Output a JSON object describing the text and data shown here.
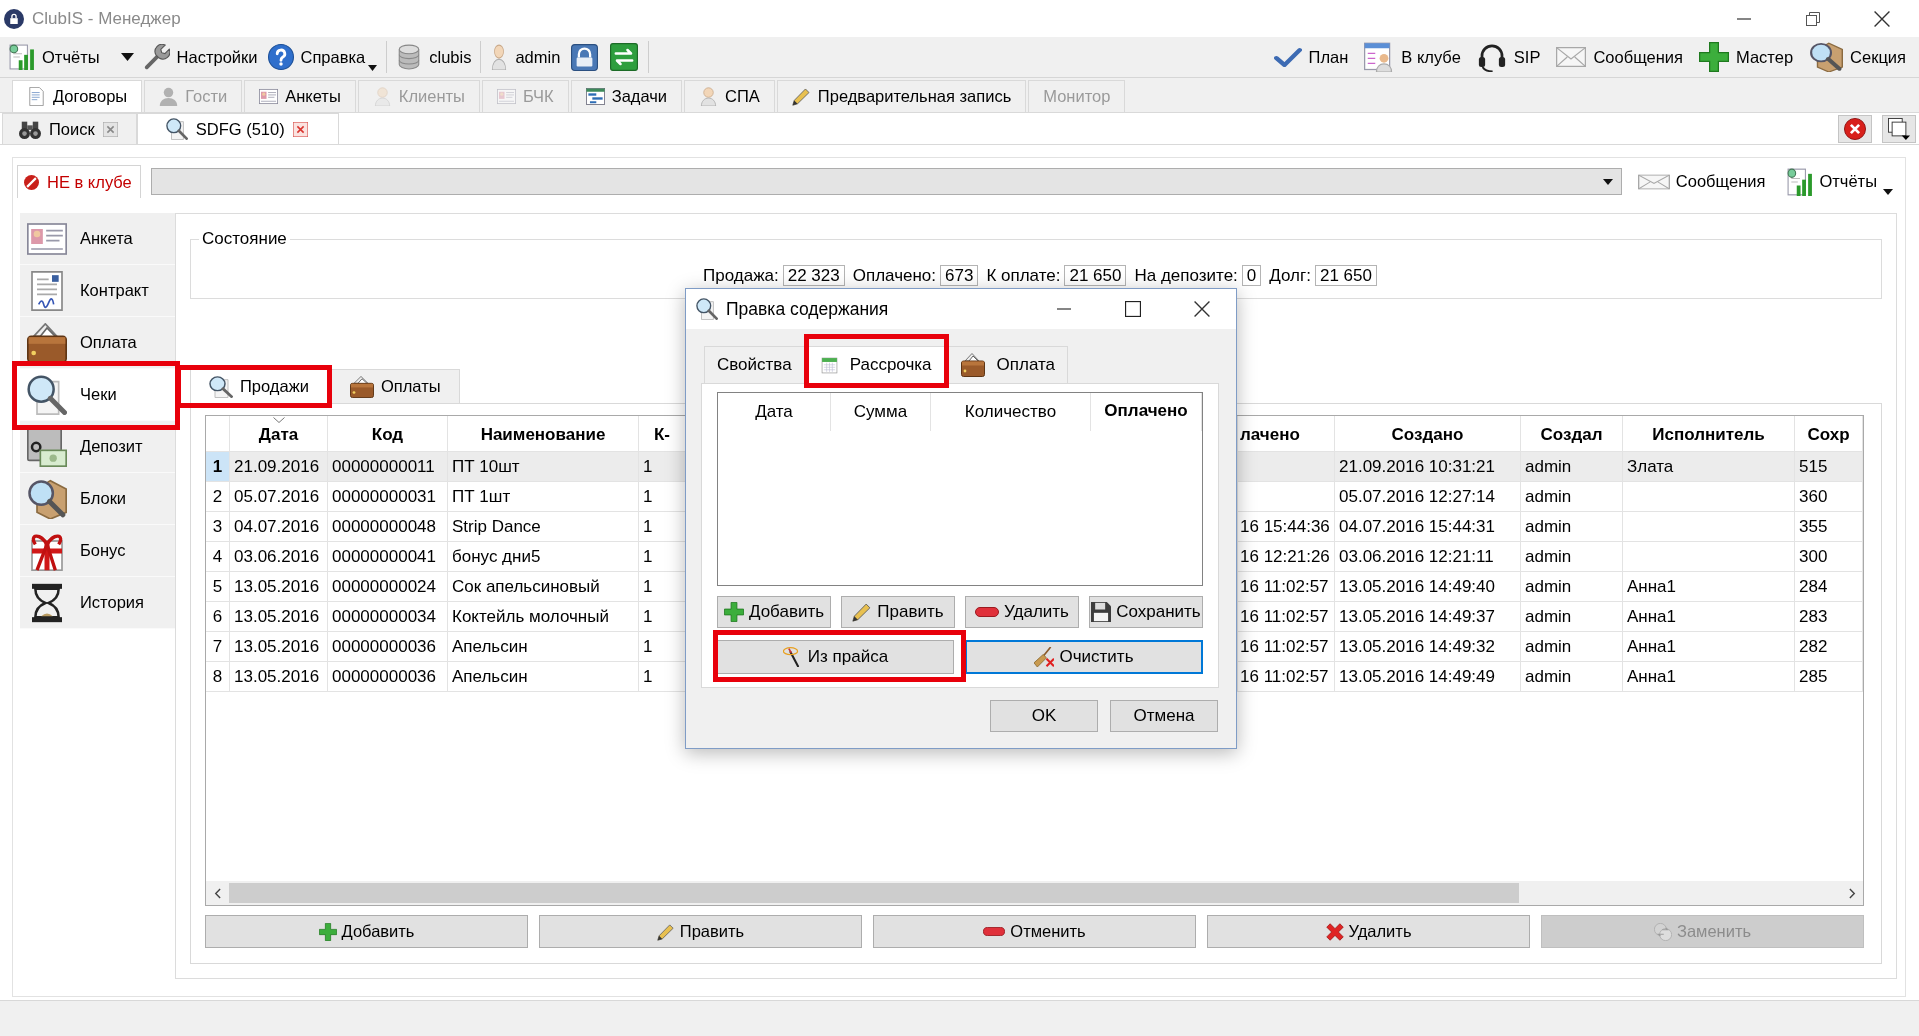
{
  "window": {
    "title": "ClubIS - Менеджер"
  },
  "toolbar": {
    "left": [
      {
        "label": "Отчёты",
        "dropdown": true
      },
      {
        "label": "Настройки",
        "dropdown": false
      },
      {
        "label": "Справка",
        "dropdown": true
      },
      {
        "label": "clubis",
        "dropdown": false
      },
      {
        "label": "admin",
        "dropdown": false
      }
    ],
    "right": [
      "План",
      "В клубе",
      "SIP",
      "Сообщения",
      "Мастер",
      "Секция"
    ]
  },
  "tabs": [
    {
      "label": "Договоры",
      "selected": true,
      "disabled": false
    },
    {
      "label": "Гости",
      "selected": false,
      "disabled": true
    },
    {
      "label": "Анкеты",
      "selected": false,
      "disabled": false
    },
    {
      "label": "Клиенты",
      "selected": false,
      "disabled": true
    },
    {
      "label": "БЧК",
      "selected": false,
      "disabled": true
    },
    {
      "label": "Задачи",
      "selected": false,
      "disabled": false
    },
    {
      "label": "СПА",
      "selected": false,
      "disabled": false
    },
    {
      "label": "Предварительная запись",
      "selected": false,
      "disabled": false
    },
    {
      "label": "Монитор",
      "selected": false,
      "disabled": true
    }
  ],
  "document_tabs": [
    {
      "label": "Поиск",
      "selected": false
    },
    {
      "label": "SDFG (510)",
      "selected": true
    }
  ],
  "client_bar": {
    "presence": "НЕ в клубе",
    "buttons": [
      {
        "label": "Сообщения",
        "dropdown": false
      },
      {
        "label": "Отчёты",
        "dropdown": true
      }
    ]
  },
  "sidebar": {
    "items": [
      {
        "label": "Анкета",
        "selected": false,
        "highlighted": false
      },
      {
        "label": "Контракт",
        "selected": false,
        "highlighted": false
      },
      {
        "label": "Оплата",
        "selected": false,
        "highlighted": false
      },
      {
        "label": "Чеки",
        "selected": true,
        "highlighted": true
      },
      {
        "label": "Депозит",
        "selected": false,
        "highlighted": false
      },
      {
        "label": "Блоки",
        "selected": false,
        "highlighted": false
      },
      {
        "label": "Бонус",
        "selected": false,
        "highlighted": false
      },
      {
        "label": "История",
        "selected": false,
        "highlighted": false
      }
    ]
  },
  "state_group": {
    "title": "Состояние",
    "fields": [
      {
        "label": "Продажа:",
        "value": "22 323"
      },
      {
        "label": "Оплачено:",
        "value": "673"
      },
      {
        "label": "К оплате:",
        "value": "21 650"
      },
      {
        "label": "На депозите:",
        "value": "0"
      },
      {
        "label": "Долг:",
        "value": "21 650"
      }
    ]
  },
  "sub_tabs": [
    {
      "label": "Продажи",
      "selected": true,
      "highlighted": true
    },
    {
      "label": "Оплаты",
      "selected": false,
      "highlighted": false
    }
  ],
  "table": {
    "columns": [
      {
        "label": "Дата",
        "sorted": true
      },
      {
        "label": "Код",
        "sorted": false
      },
      {
        "label": "Наименование",
        "sorted": false
      },
      {
        "label": "К-",
        "sorted": false
      },
      {
        "label": "лачено",
        "sorted": false
      },
      {
        "label": "Создано",
        "sorted": false
      },
      {
        "label": "Создал",
        "sorted": false
      },
      {
        "label": "Исполнитель",
        "sorted": false
      },
      {
        "label": "Сохр",
        "sorted": false
      }
    ],
    "rows": [
      {
        "number": "1",
        "selected": true,
        "date": "21.09.2016",
        "code": "00000000011",
        "name": "ПТ 10шт",
        "column_4": "1",
        "created": "21.09.2016 10:31:21",
        "created_by": "admin",
        "performer": "Злата",
        "column_9": "515"
      },
      {
        "number": "2",
        "selected": false,
        "date": "05.07.2016",
        "code": "00000000031",
        "name": "ПТ 1шт",
        "column_4": "1",
        "created": "05.07.2016 12:27:14",
        "created_by": "admin",
        "column_9": "360"
      },
      {
        "number": "3",
        "selected": false,
        "date": "04.07.2016",
        "code": "00000000048",
        "name": "Strip Dance",
        "column_4": "1",
        "column_5": "16 15:44:36",
        "created": "04.07.2016 15:44:31",
        "created_by": "admin",
        "column_9": "355"
      },
      {
        "number": "4",
        "selected": false,
        "date": "03.06.2016",
        "code": "00000000041",
        "name": "бонус дни5",
        "column_4": "1",
        "column_5": "16 12:21:26",
        "created": "03.06.2016 12:21:11",
        "created_by": "admin",
        "column_9": "300"
      },
      {
        "number": "5",
        "selected": false,
        "date": "13.05.2016",
        "code": "00000000024",
        "name": "Сок апельсиновый",
        "column_4": "1",
        "column_5": "16 11:02:57",
        "created": "13.05.2016 14:49:40",
        "created_by": "admin",
        "performer": "Анна1",
        "column_9": "284"
      },
      {
        "number": "6",
        "selected": false,
        "date": "13.05.2016",
        "code": "00000000034",
        "name": "Коктейль молочный",
        "column_4": "1",
        "column_5": "16 11:02:57",
        "created": "13.05.2016 14:49:37",
        "created_by": "admin",
        "performer": "Анна1",
        "column_9": "283"
      },
      {
        "number": "7",
        "selected": false,
        "date": "13.05.2016",
        "code": "00000000036",
        "name": "Апельсин",
        "column_4": "1",
        "column_5": "16 11:02:57",
        "created": "13.05.2016 14:49:32",
        "created_by": "admin",
        "performer": "Анна1",
        "column_9": "282"
      },
      {
        "number": "8",
        "selected": false,
        "date": "13.05.2016",
        "code": "00000000036",
        "name": "Апельсин",
        "column_4": "1",
        "column_5": "16 11:02:57",
        "created": "13.05.2016 14:49:49",
        "created_by": "admin",
        "performer": "Анна1",
        "column_9": "285"
      }
    ]
  },
  "actions": [
    {
      "kind": "add",
      "label": "Добавить",
      "disabled": false
    },
    {
      "kind": "edit",
      "label": "Править",
      "disabled": false
    },
    {
      "kind": "remove",
      "label": "Отменить",
      "disabled": false
    },
    {
      "kind": "delete",
      "label": "Удалить",
      "disabled": false
    },
    {
      "kind": "replace",
      "label": "Заменить",
      "disabled": true
    }
  ],
  "dialog": {
    "title": "Правка содержания",
    "tabs": [
      {
        "label": "Свойства",
        "selected": false,
        "highlighted": false
      },
      {
        "label": "Рассрочка",
        "selected": true,
        "highlighted": true
      },
      {
        "label": "Оплата",
        "selected": false,
        "highlighted": false
      }
    ],
    "table": {
      "columns": [
        {
          "label": "Дата",
          "selected": false
        },
        {
          "label": "Сумма",
          "selected": false
        },
        {
          "label": "Количество",
          "selected": false
        },
        {
          "label": "Оплачено",
          "selected": true
        }
      ]
    },
    "buttons": [
      {
        "kind": "add",
        "label": "Добавить"
      },
      {
        "kind": "edit",
        "label": "Править"
      },
      {
        "kind": "remove",
        "label": "Удалить"
      },
      {
        "kind": "save",
        "label": "Сохранить"
      }
    ],
    "wide_buttons": [
      {
        "kind": "price",
        "label": "Из прайса",
        "highlighted": true,
        "focused": false
      },
      {
        "kind": "clear",
        "label": "Очистить",
        "highlighted": false,
        "focused": true
      }
    ],
    "footer_buttons": [
      "OK",
      "Отмена"
    ]
  }
}
